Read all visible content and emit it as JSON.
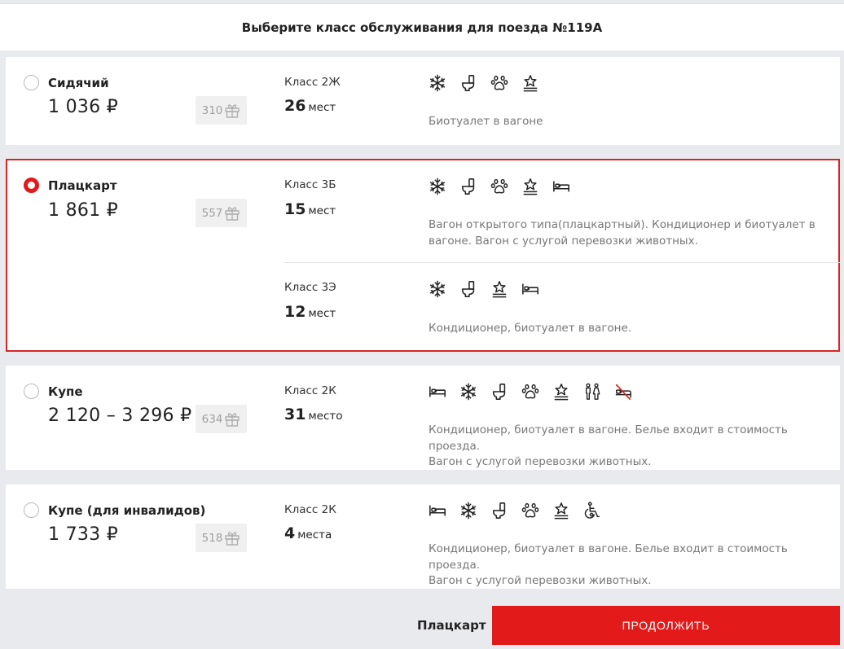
{
  "header": {
    "title": "Выберите класс обслуживания для поезда №119А"
  },
  "options": [
    {
      "name": "Сидячий",
      "price": "1 036 ₽",
      "bonus": "310",
      "selected": false,
      "cars": [
        {
          "class_label": "Класс 2Ж",
          "seats_count": "26",
          "seats_word": "мест",
          "icons": [
            "snowflake-icon",
            "toilet-icon",
            "paw-icon",
            "star-service-icon"
          ],
          "description": "Биотуалет в вагоне"
        }
      ]
    },
    {
      "name": "Плацкарт",
      "price": "1 861 ₽",
      "bonus": "557",
      "selected": true,
      "cars": [
        {
          "class_label": "Класс 3Б",
          "seats_count": "15",
          "seats_word": "мест",
          "icons": [
            "snowflake-icon",
            "toilet-icon",
            "paw-icon",
            "star-service-icon",
            "bed-icon"
          ],
          "description_lines": [
            "Вагон открытого типа(плацкартный). Кондиционер и биотуалет в",
            "вагоне. Вагон с услугой перевозки животных."
          ]
        },
        {
          "class_label": "Класс 3Э",
          "seats_count": "12",
          "seats_word": "мест",
          "icons": [
            "snowflake-icon",
            "toilet-icon",
            "star-service-icon",
            "bed-icon"
          ],
          "description": "Кондиционер, биотуалет в вагоне."
        }
      ]
    },
    {
      "name": "Купе",
      "price": "2 120 – 3 296 ₽",
      "bonus": "634",
      "selected": false,
      "cars": [
        {
          "class_label": "Класс 2К",
          "seats_count": "31",
          "seats_word": "место",
          "icons": [
            "bed-icon",
            "snowflake-icon",
            "toilet-icon",
            "paw-icon",
            "star-service-icon",
            "mixed-gender-icon",
            "no-bedding-icon"
          ],
          "description_lines": [
            "Кондиционер, биотуалет в вагоне. Белье входит в стоимость проезда.",
            "Вагон с услугой перевозки животных."
          ]
        }
      ]
    },
    {
      "name": "Купе (для инвалидов)",
      "price": "1 733 ₽",
      "bonus": "518",
      "selected": false,
      "cars": [
        {
          "class_label": "Класс 2К",
          "seats_count": "4",
          "seats_word": "места",
          "icons": [
            "bed-icon",
            "snowflake-icon",
            "toilet-icon",
            "paw-icon",
            "star-service-icon",
            "wheelchair-icon"
          ],
          "description_lines": [
            "Кондиционер, биотуалет в вагоне. Белье входит в стоимость проезда.",
            "Вагон с услугой перевозки животных."
          ]
        }
      ]
    }
  ],
  "footer": {
    "selected_label": "Плацкарт",
    "continue_label": "ПРОДОЛЖИТЬ"
  },
  "colors": {
    "accent": "#e21a1a",
    "selected_border": "#d62626",
    "muted_text": "#777777",
    "page_bg": "#e9eaee"
  }
}
